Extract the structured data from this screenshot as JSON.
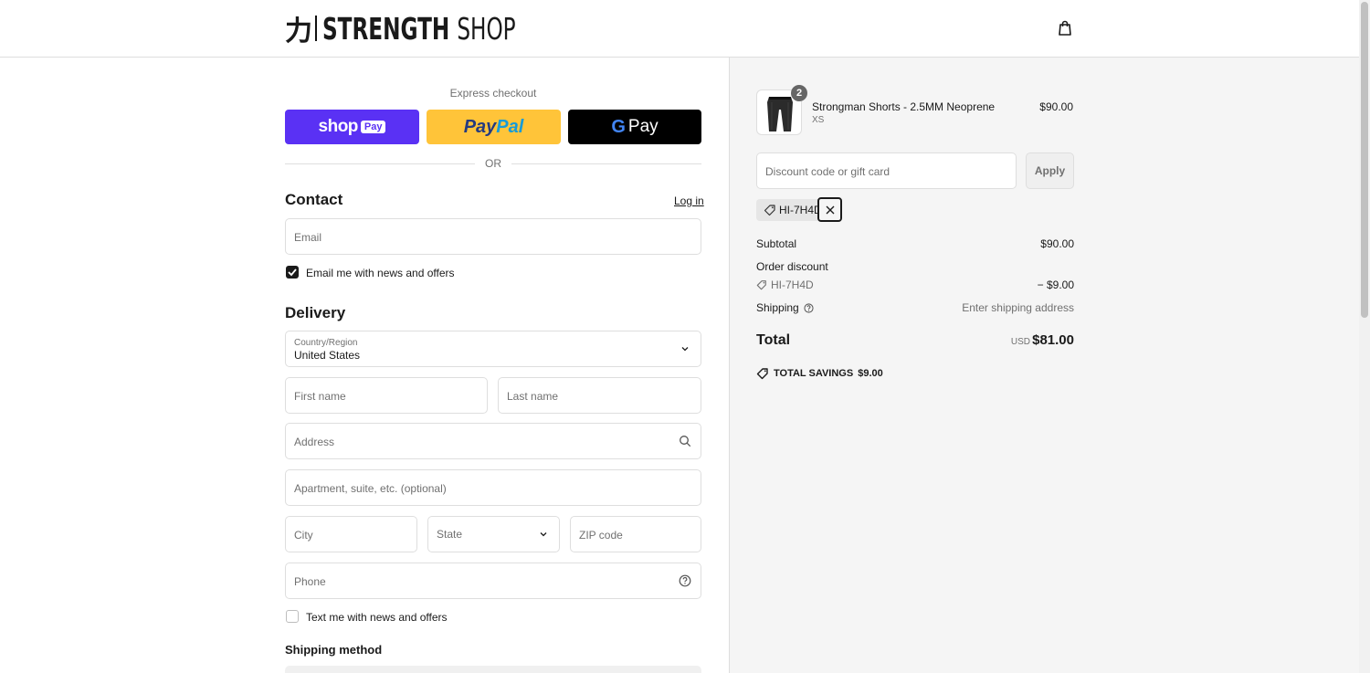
{
  "header": {
    "brand_mark": "力",
    "brand_bold": "STRENGTH",
    "brand_thin": "SHOP"
  },
  "express": {
    "label": "Express checkout",
    "shoppay_text": "shop",
    "shoppay_badge": "Pay",
    "paypal_a": "Pay",
    "paypal_b": "Pal",
    "gpay_g": "G",
    "gpay_text": "Pay",
    "or_text": "OR"
  },
  "contact": {
    "heading": "Contact",
    "login_label": "Log in",
    "email_placeholder": "Email",
    "news_checkbox_label": "Email me with news and offers",
    "news_checked": true
  },
  "delivery": {
    "heading": "Delivery",
    "country_label": "Country/Region",
    "country_value": "United States",
    "first_name_placeholder": "First name",
    "last_name_placeholder": "Last name",
    "address_placeholder": "Address",
    "apartment_placeholder": "Apartment, suite, etc. (optional)",
    "city_placeholder": "City",
    "state_placeholder": "State",
    "zip_placeholder": "ZIP code",
    "phone_placeholder": "Phone",
    "sms_checkbox_label": "Text me with news and offers",
    "sms_checked": false
  },
  "shipping_method": {
    "heading": "Shipping method"
  },
  "order": {
    "item": {
      "quantity": "2",
      "name": "Strongman Shorts - 2.5MM Neoprene",
      "variant": "XS",
      "price": "$90.00"
    },
    "discount_placeholder": "Discount code or gift card",
    "apply_label": "Apply",
    "applied_code": "HI-7H4D",
    "subtotal_label": "Subtotal",
    "subtotal_value": "$90.00",
    "order_discount_label": "Order discount",
    "discount_code": "HI-7H4D",
    "discount_value": "− $9.00",
    "shipping_label": "Shipping",
    "shipping_value": "Enter shipping address",
    "total_label": "Total",
    "total_currency": "USD",
    "total_value": "$81.00",
    "savings_label": "TOTAL SAVINGS",
    "savings_value": "$9.00"
  },
  "colors": {
    "shoppay": "#5a31f4",
    "paypal": "#ffc439",
    "gpay": "#000000",
    "summary_bg": "#f5f5f5"
  }
}
